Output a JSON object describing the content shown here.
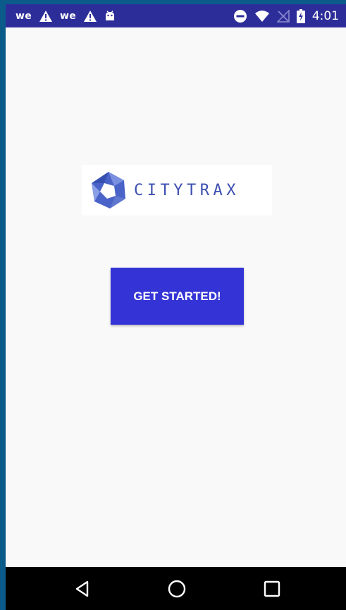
{
  "status_bar": {
    "left_labels": [
      "we",
      "we"
    ],
    "time": "4:01",
    "icons": [
      "warning-icon",
      "warning-icon",
      "android-debug-icon",
      "do-not-disturb-icon",
      "wifi-icon",
      "no-signal-icon",
      "battery-charging-icon"
    ]
  },
  "app": {
    "logo_text": "CITYTRAX",
    "cta_label": "GET STARTED!"
  },
  "nav_bar": {
    "buttons": [
      "back",
      "home",
      "recents"
    ]
  },
  "colors": {
    "status_bar": "#2d2d9a",
    "app_background": "#f9f9f9",
    "primary_button": "#3434d6",
    "logo_text": "#3d4fb0",
    "nav_bar": "#000000",
    "frame": "#0a5a8a"
  }
}
